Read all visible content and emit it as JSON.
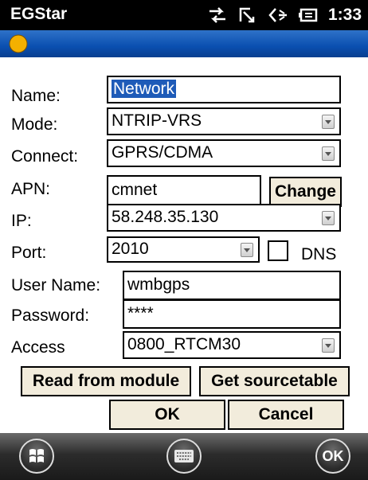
{
  "status_bar": {
    "app_title": "EGStar",
    "time": "1:33",
    "icons": [
      "connection-icon",
      "signal-icon",
      "volume-icon",
      "battery-icon"
    ]
  },
  "header": {
    "logo_icon": "egstar-logo-icon",
    "accent_color": "#0a4fb0"
  },
  "form": {
    "name": {
      "label": "Name:",
      "value": "Network"
    },
    "mode": {
      "label": "Mode:",
      "value": "NTRIP-VRS"
    },
    "connect": {
      "label": "Connect:",
      "value": "GPRS/CDMA"
    },
    "apn": {
      "label": "APN:",
      "value": "cmnet",
      "button": "Change"
    },
    "ip": {
      "label": "IP:",
      "value": "58.248.35.130"
    },
    "port": {
      "label": "Port:",
      "value": "2010",
      "dns_label": "DNS",
      "dns_checked": false
    },
    "user_name": {
      "label": "User Name:",
      "value": "wmbgps"
    },
    "password": {
      "label": "Password:",
      "value": "****"
    },
    "access": {
      "label": "Access",
      "value": "0800_RTCM30"
    }
  },
  "buttons": {
    "read_from_module": "Read from module",
    "get_sourcetable": "Get sourcetable",
    "ok": "OK",
    "cancel": "Cancel"
  },
  "taskbar": {
    "start_icon": "windows-start-icon",
    "keyboard_icon": "keyboard-icon",
    "ok_label": "OK"
  }
}
